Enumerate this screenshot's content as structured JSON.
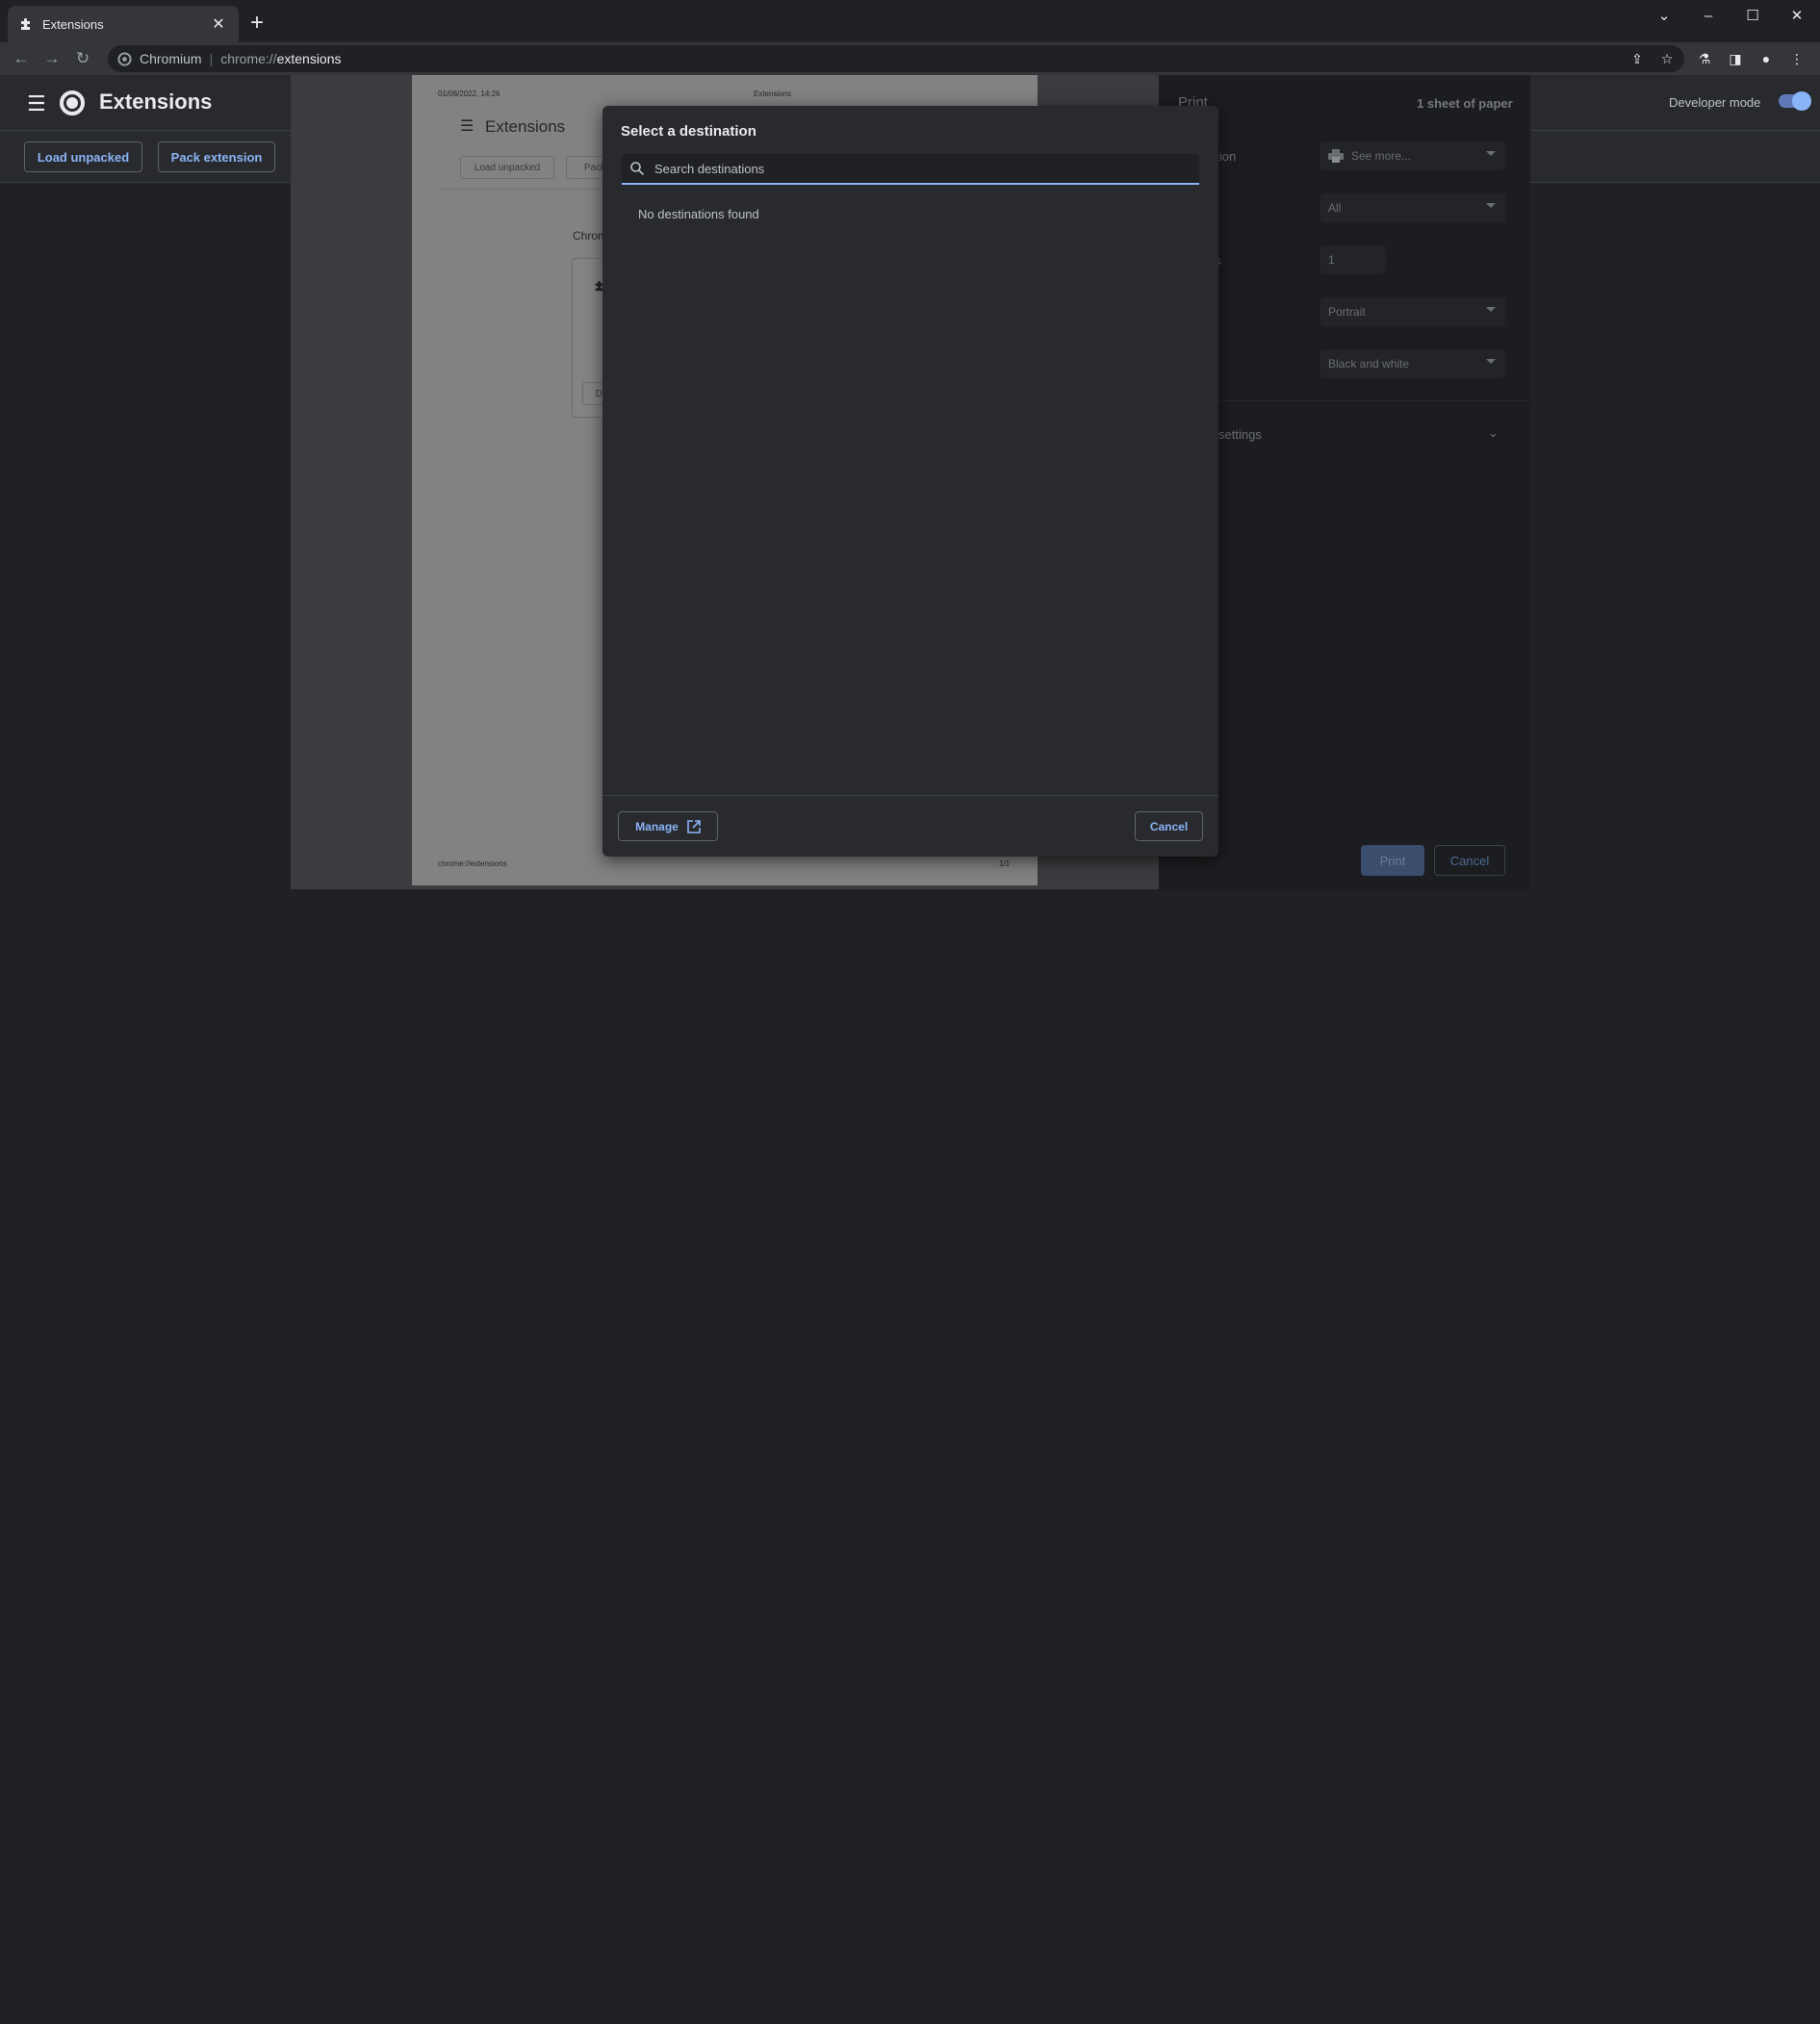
{
  "browser": {
    "tab_title": "Extensions",
    "site_name": "Chromium",
    "url_scheme": "chrome://",
    "url_host": "extensions"
  },
  "extensions_page": {
    "title": "Extensions",
    "load_unpacked": "Load unpacked",
    "pack_extension": "Pack extension",
    "developer_mode_label": "Developer mode",
    "developer_mode_on": true
  },
  "preview": {
    "date": "01/08/2022, 14:26",
    "header_title": "Extensions",
    "page_title": "Extensions",
    "load_unpacked": "Load unpacked",
    "pack": "Pack",
    "section": "Chrom",
    "card_button": "De",
    "footer_url": "chrome://extensions",
    "page_count": "1/1"
  },
  "print_panel": {
    "title": "Print",
    "sheets": "1 sheet of paper",
    "destination_label": "ation",
    "destination_value": "See more...",
    "pages_value": "All",
    "copies_label": "s",
    "copies_value": "1",
    "layout_label": "t",
    "layout_value": "Portrait",
    "colour_value": "Black and white",
    "more_settings": "settings",
    "print_button": "Print",
    "cancel_button": "Cancel"
  },
  "destination_dialog": {
    "title": "Select a destination",
    "search_placeholder": "Search destinations",
    "empty_message": "No destinations found",
    "manage_button": "Manage",
    "cancel_button": "Cancel"
  },
  "colors": {
    "accent": "#8ab4f8",
    "background": "#202124",
    "surface": "#292a2d"
  }
}
